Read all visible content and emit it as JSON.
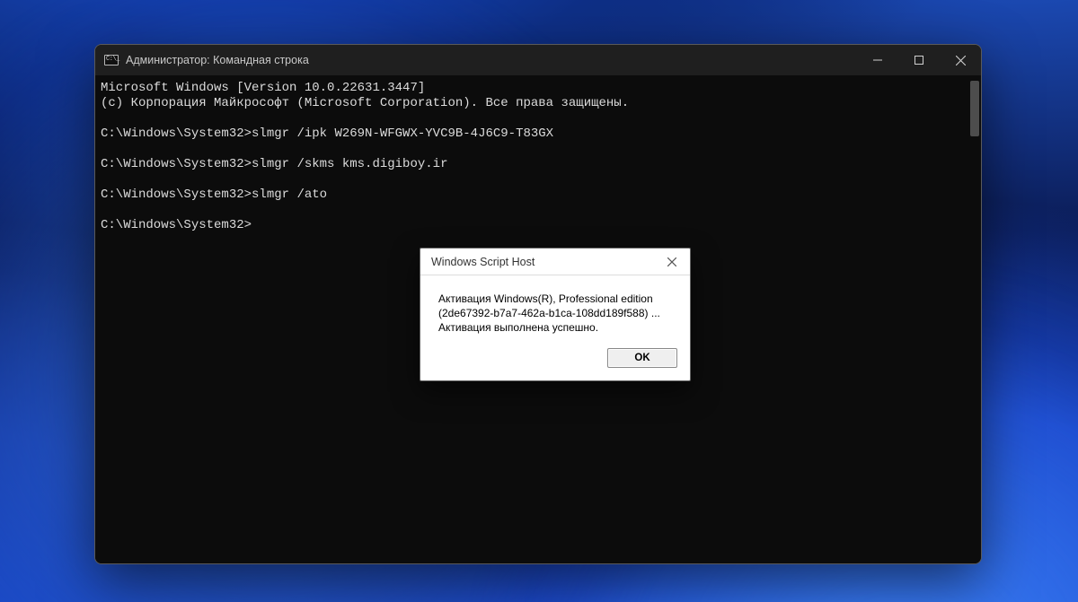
{
  "window": {
    "title": "Администратор: Командная строка"
  },
  "terminal": {
    "banner1": "Microsoft Windows [Version 10.0.22631.3447]",
    "banner2": "(c) Корпорация Майкрософт (Microsoft Corporation). Все права защищены.",
    "prompt": "C:\\Windows\\System32>",
    "cmd1": "slmgr /ipk W269N-WFGWX-YVC9B-4J6C9-T83GX",
    "cmd2": "slmgr /skms kms.digiboy.ir",
    "cmd3": "slmgr /ato"
  },
  "dialog": {
    "title": "Windows Script Host",
    "line1": "Активация Windows(R), Professional edition",
    "line2": "(2de67392-b7a7-462a-b1ca-108dd189f588) ...",
    "line3": "Активация выполнена успешно.",
    "ok": "OK"
  }
}
